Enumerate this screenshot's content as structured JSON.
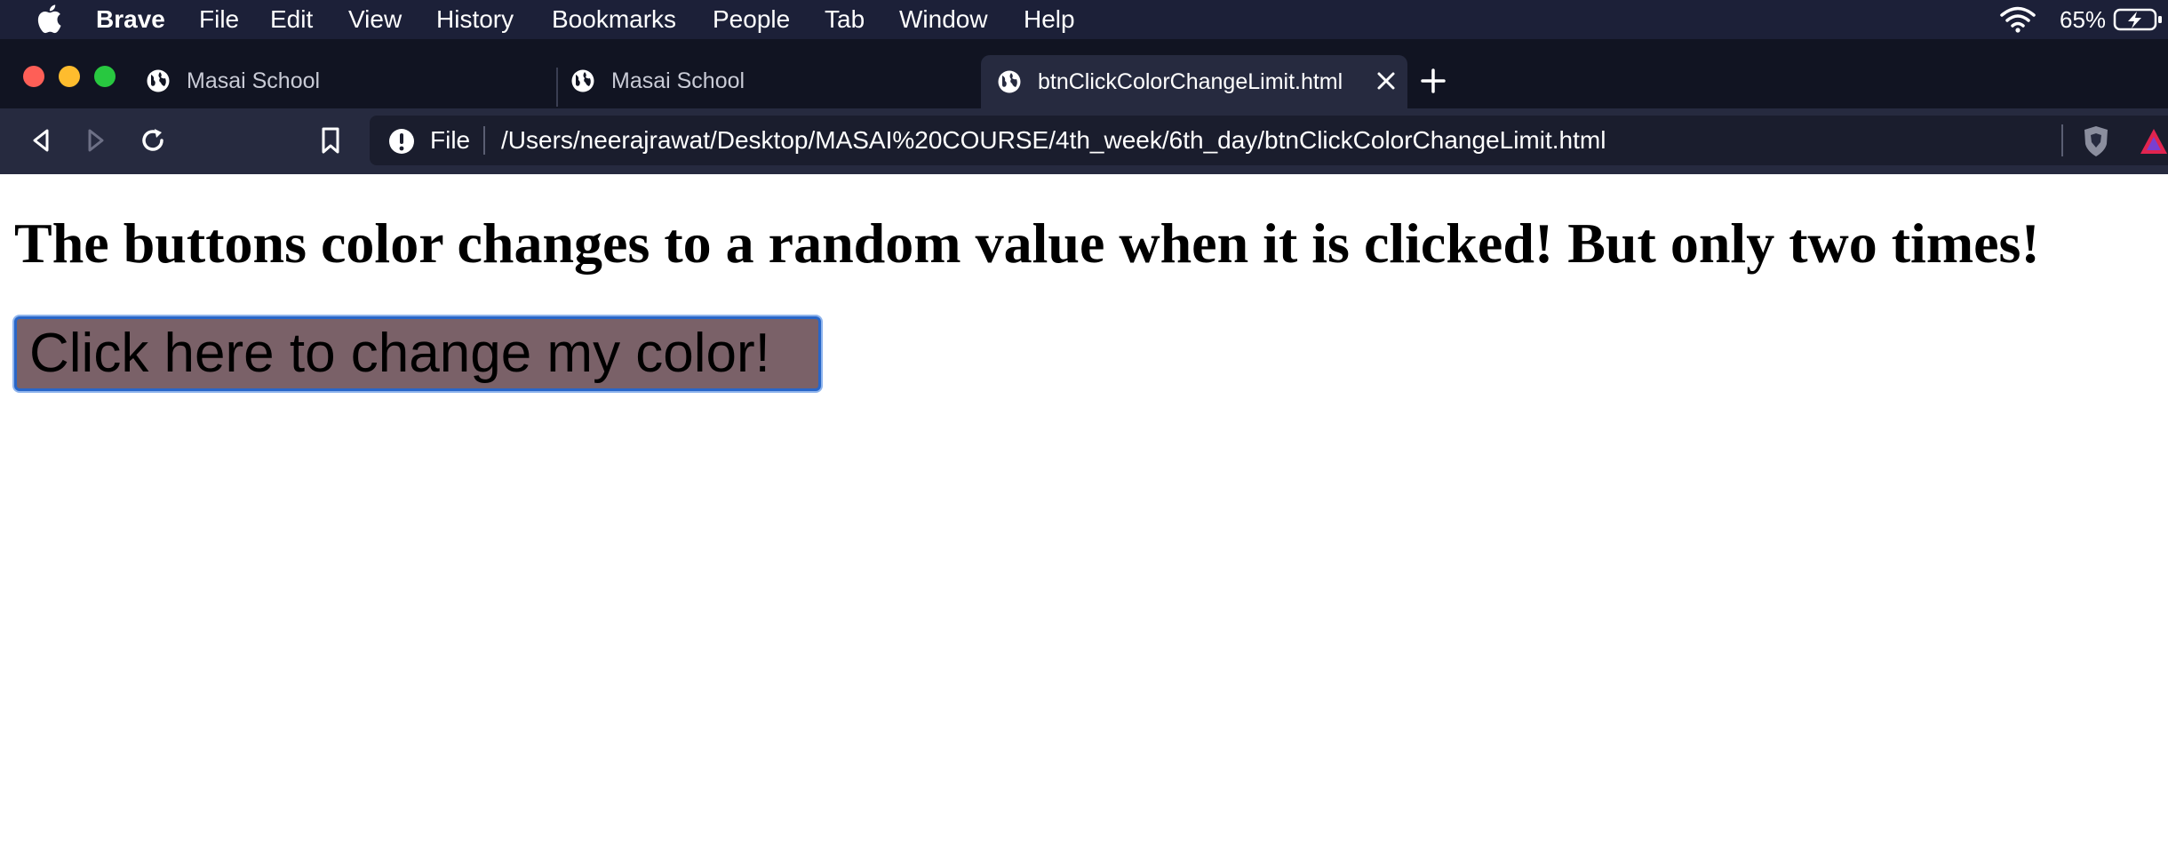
{
  "menubar": {
    "app_name": "Brave",
    "items": [
      "File",
      "Edit",
      "View",
      "History",
      "Bookmarks",
      "People",
      "Tab",
      "Window",
      "Help"
    ],
    "battery_percent": "65%",
    "icons": [
      "apple-logo-icon",
      "wifi-icon",
      "battery-charging-icon"
    ]
  },
  "tabs": [
    {
      "title": "Masai School",
      "icon": "globe-icon",
      "active": false
    },
    {
      "title": "Masai School",
      "icon": "globe-icon",
      "active": false
    },
    {
      "title": "btnClickColorChangeLimit.html",
      "icon": "globe-icon",
      "active": true
    }
  ],
  "toolbar": {
    "icons": [
      "back-icon",
      "forward-icon",
      "reload-icon",
      "bookmark-icon",
      "info-icon",
      "brave-shield-icon",
      "brave-rewards-icon"
    ],
    "url_scheme_label": "File",
    "url": "/Users/neerajrawat/Desktop/MASAI%20COURSE/4th_week/6th_day/btnClickColorChangeLimit.html"
  },
  "page": {
    "heading": "The buttons color changes to a random value when it is clicked! But only two times!",
    "button_label": "Click here to change my color!",
    "button_color": "#7a6168"
  },
  "colors": {
    "menubar_bg": "#1c2038",
    "tabstrip_bg": "#111422",
    "toolbar_bg": "#262a3f",
    "traffic_red": "#fe5f57",
    "traffic_yellow": "#febc2e",
    "traffic_green": "#28c840",
    "focus_ring": "#2866c8"
  }
}
